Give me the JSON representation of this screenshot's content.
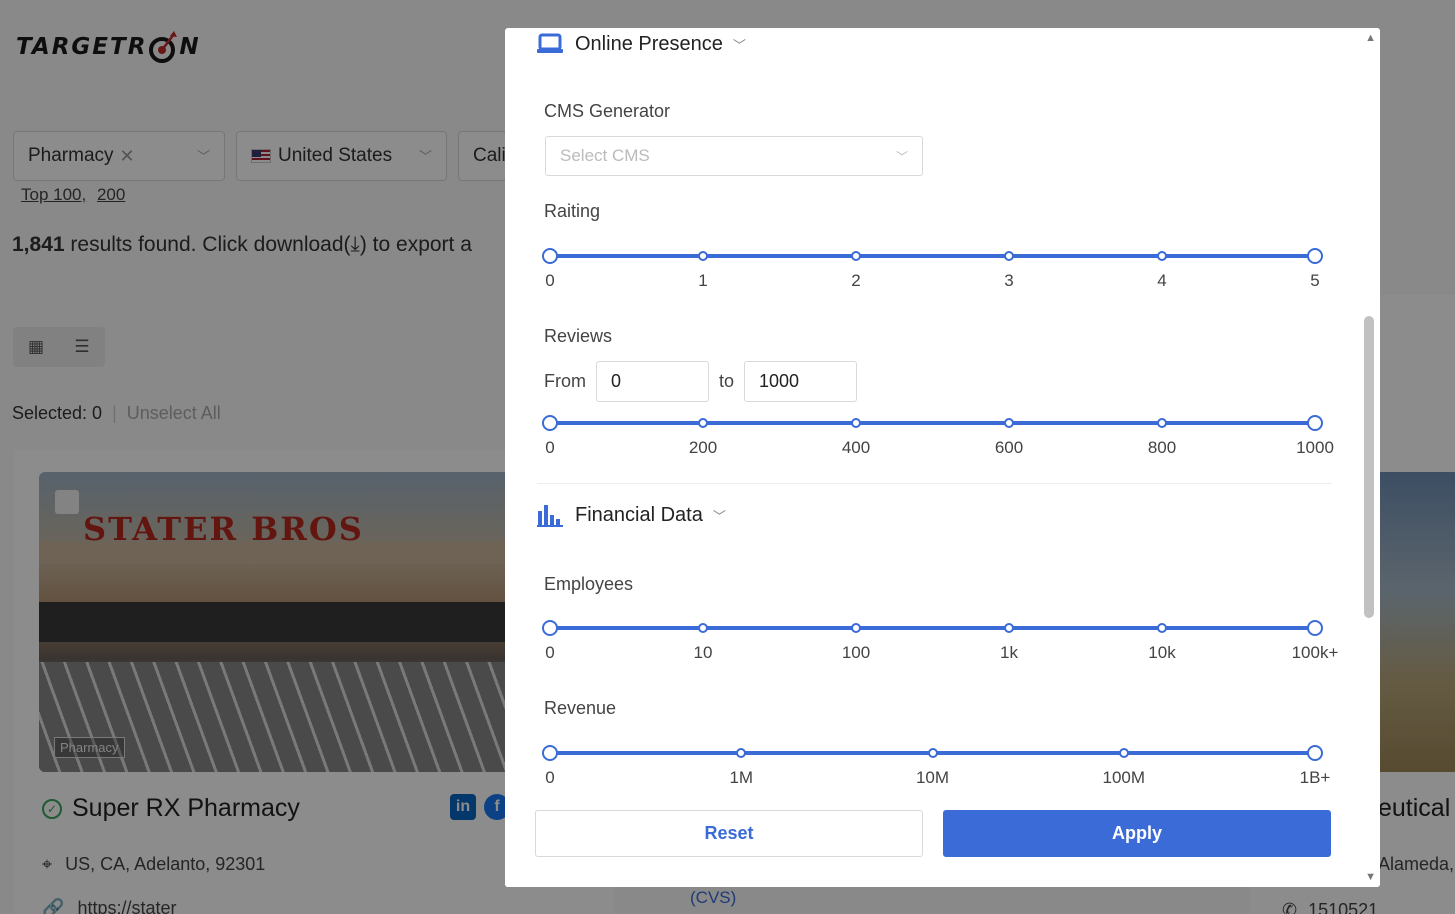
{
  "background": {
    "logo_text_left": "TARGETR",
    "logo_text_right": "N",
    "filters": [
      {
        "label": "Pharmacy"
      },
      {
        "label": "United States"
      },
      {
        "label": "Cali"
      }
    ],
    "top_link_1": "Top 100,",
    "top_link_2": "200",
    "results_count": "1,841",
    "results_text": " results found. Click download(",
    "results_text_2": ") to export a",
    "selected_text": "Selected: 0",
    "unselect_all": "Unselect All",
    "card": {
      "image_sign": "STATER BROS",
      "image_tag": "Pharmacy",
      "title": "Super RX Pharmacy",
      "address": "US, CA, Adelanto, 92301",
      "url": "https://stater"
    },
    "right_card": {
      "title": "eutical",
      "address": "Alameda,",
      "phone": "1510521",
      "cvs_text": "(CVS)"
    }
  },
  "modal": {
    "online_presence": {
      "title": "Online Presence",
      "cms_label": "CMS Generator",
      "cms_placeholder": "Select CMS",
      "rating_label": "Raiting",
      "rating_ticks": [
        "0",
        "1",
        "2",
        "3",
        "4",
        "5"
      ],
      "rating_range": [
        0,
        5
      ],
      "reviews_label": "Reviews",
      "reviews_from_label": "From",
      "reviews_from_value": "0",
      "reviews_to_label": "to",
      "reviews_to_value": "1000",
      "reviews_ticks": [
        "0",
        "200",
        "400",
        "600",
        "800",
        "1000"
      ],
      "reviews_range": [
        0,
        1000
      ]
    },
    "financial_data": {
      "title": "Financial Data",
      "employees_label": "Employees",
      "employees_ticks": [
        "0",
        "10",
        "100",
        "1k",
        "10k",
        "100k+"
      ],
      "revenue_label": "Revenue",
      "revenue_ticks": [
        "0",
        "1M",
        "10M",
        "100M",
        "1B+"
      ]
    },
    "reset_label": "Reset",
    "apply_label": "Apply"
  },
  "colors": {
    "accent": "#3b6bd6",
    "overlay": "rgba(0,0,0,0.45)",
    "check_green": "#3aa55b",
    "linkedin": "#0a66c2",
    "facebook": "#1877f2"
  }
}
